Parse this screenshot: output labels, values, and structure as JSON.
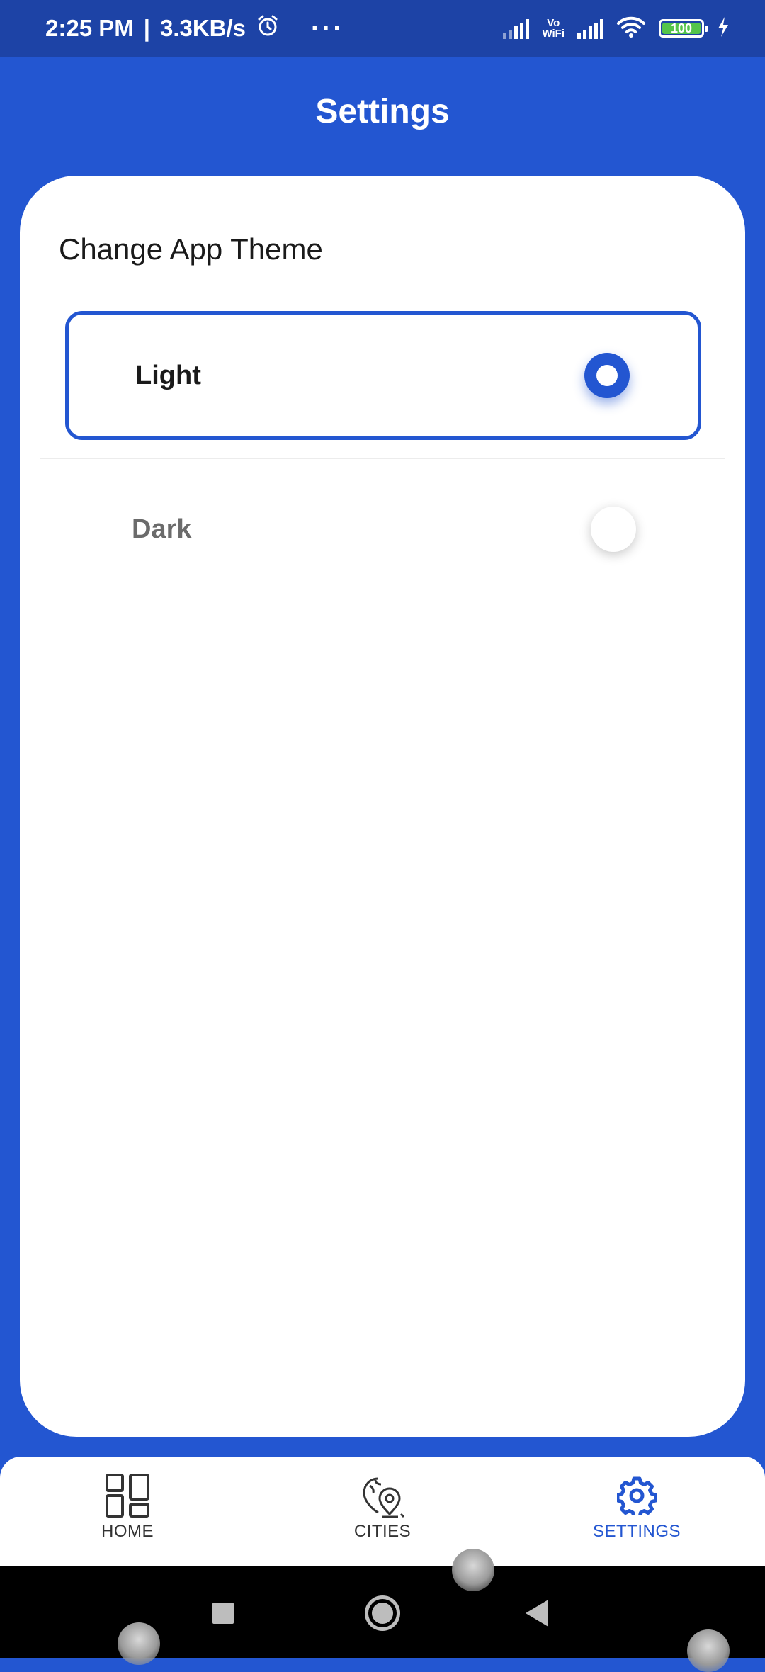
{
  "status_bar": {
    "time": "2:25 PM",
    "speed": "3.3KB/s",
    "more": "···",
    "vowifi_top": "Vo",
    "vowifi_bottom": "WiFi",
    "battery": "100"
  },
  "header": {
    "title": "Settings"
  },
  "theme": {
    "section_title": "Change App Theme",
    "options": [
      {
        "label": "Light",
        "selected": true
      },
      {
        "label": "Dark",
        "selected": false
      }
    ]
  },
  "bottom_nav": {
    "items": [
      {
        "label": "HOME",
        "icon": "dashboard-icon",
        "active": false
      },
      {
        "label": "CITIES",
        "icon": "map-pin-icon",
        "active": false
      },
      {
        "label": "SETTINGS",
        "icon": "gear-icon",
        "active": true
      }
    ]
  },
  "colors": {
    "primary": "#2356d1",
    "status_bar": "#1d43a6",
    "battery": "#54c44a"
  },
  "system_nav": [
    "recents-button",
    "home-button",
    "back-button"
  ]
}
